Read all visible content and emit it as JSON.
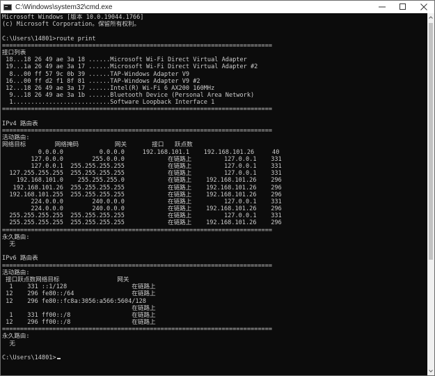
{
  "window": {
    "title": "C:\\Windows\\system32\\cmd.exe",
    "icon": "console-icon",
    "buttons": [
      "minimize-icon",
      "maximize-icon",
      "close-icon"
    ]
  },
  "colors": {
    "console_bg": "#0c0c0c",
    "console_text": "#cccccc",
    "titlebar_bg": "#ffffff"
  },
  "console": {
    "lines": [
      "Microsoft Windows [版本 10.0.19044.1766]",
      "(c) Microsoft Corporation。保留所有权利。",
      "",
      "C:\\Users\\14801>route print",
      "===========================================================================",
      "接口列表",
      " 18...18 26 49 ae 3a 18 ......Microsoft Wi-Fi Direct Virtual Adapter",
      " 19...1a 26 49 ae 3a 17 ......Microsoft Wi-Fi Direct Virtual Adapter #2",
      "  8...00 ff 57 9c 0b 39 ......TAP-Windows Adapter V9",
      " 16...00 ff d2 f1 8f 81 ......TAP-Windows Adapter V9 #2",
      " 12...18 26 49 ae 3a 17 ......Intel(R) Wi-Fi 6 AX200 160MHz",
      "  9...18 26 49 ae 3a 1b ......Bluetooth Device (Personal Area Network)",
      "  1...........................Software Loopback Interface 1",
      "===========================================================================",
      "",
      "IPv4 路由表",
      "===========================================================================",
      "活动路由:",
      "网络目标        网络掩码          网关       接口   跃点数",
      "          0.0.0.0          0.0.0.0     192.168.101.1    192.168.101.26     40",
      "        127.0.0.0        255.0.0.0            在链路上         127.0.0.1    331",
      "        127.0.0.1  255.255.255.255            在链路上         127.0.0.1    331",
      "  127.255.255.255  255.255.255.255            在链路上         127.0.0.1    331",
      "    192.168.101.0    255.255.255.0            在链路上    192.168.101.26    296",
      "   192.168.101.26  255.255.255.255            在链路上    192.168.101.26    296",
      "  192.168.101.255  255.255.255.255            在链路上    192.168.101.26    296",
      "        224.0.0.0        240.0.0.0            在链路上         127.0.0.1    331",
      "        224.0.0.0        240.0.0.0            在链路上    192.168.101.26    296",
      "  255.255.255.255  255.255.255.255            在链路上         127.0.0.1    331",
      "  255.255.255.255  255.255.255.255            在链路上    192.168.101.26    296",
      "===========================================================================",
      "永久路由:",
      "  无",
      "",
      "IPv6 路由表",
      "===========================================================================",
      "活动路由:",
      " 接口跃点数网络目标                网关",
      "  1    331 ::1/128                  在链路上",
      " 12    296 fe80::/64                在链路上",
      " 12    296 fe80::fc8a:3056:a566:5604/128",
      "                                    在链路上",
      "  1    331 ff00::/8                 在链路上",
      " 12    296 ff00::/8                 在链路上",
      "===========================================================================",
      "永久路由:",
      "  无",
      "",
      "C:\\Users\\14801>"
    ]
  }
}
